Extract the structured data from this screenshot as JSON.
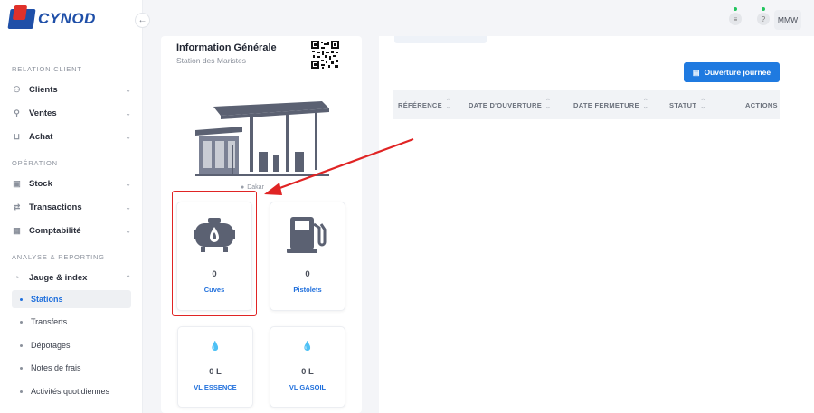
{
  "app": {
    "logo_text": "CYNOD",
    "collapse_icon": "←"
  },
  "sidebar": {
    "sections": [
      {
        "title": "RELATION CLIENT"
      },
      {
        "title": "OPÉRATION"
      },
      {
        "title": "ANALYSE & REPORTING"
      }
    ],
    "items": [
      {
        "label": "Clients"
      },
      {
        "label": "Ventes"
      },
      {
        "label": "Achat"
      },
      {
        "label": "Stock"
      },
      {
        "label": "Transactions"
      },
      {
        "label": "Comptabilité"
      },
      {
        "label": "Jauge & index"
      }
    ],
    "subitems": [
      {
        "label": "Stations"
      },
      {
        "label": "Transferts"
      },
      {
        "label": "Dépotages"
      },
      {
        "label": "Notes de frais"
      },
      {
        "label": "Activités quotidiennes"
      }
    ]
  },
  "topbar": {
    "user_initials": "MMW"
  },
  "info": {
    "title": "Information Générale",
    "subtitle": "Station des Maristes",
    "location": "Dakar"
  },
  "tiles": [
    {
      "value": "0",
      "label": "Cuves"
    },
    {
      "value": "0",
      "label": "Pistolets"
    },
    {
      "value": "0 L",
      "label": "VL ESSENCE"
    },
    {
      "value": "0 L",
      "label": "VL GASOIL"
    }
  ],
  "main": {
    "open_button": "Ouverture journée",
    "columns": [
      {
        "label": "RÉFÉRENCE"
      },
      {
        "label": "DATE D'OUVERTURE"
      },
      {
        "label": "DATE FERMETURE"
      },
      {
        "label": "STATUT"
      },
      {
        "label": "ACTIONS"
      }
    ]
  },
  "colors": {
    "accent": "#1f7ae0",
    "highlight": "#e02424",
    "active_text": "#1f6fdc"
  }
}
